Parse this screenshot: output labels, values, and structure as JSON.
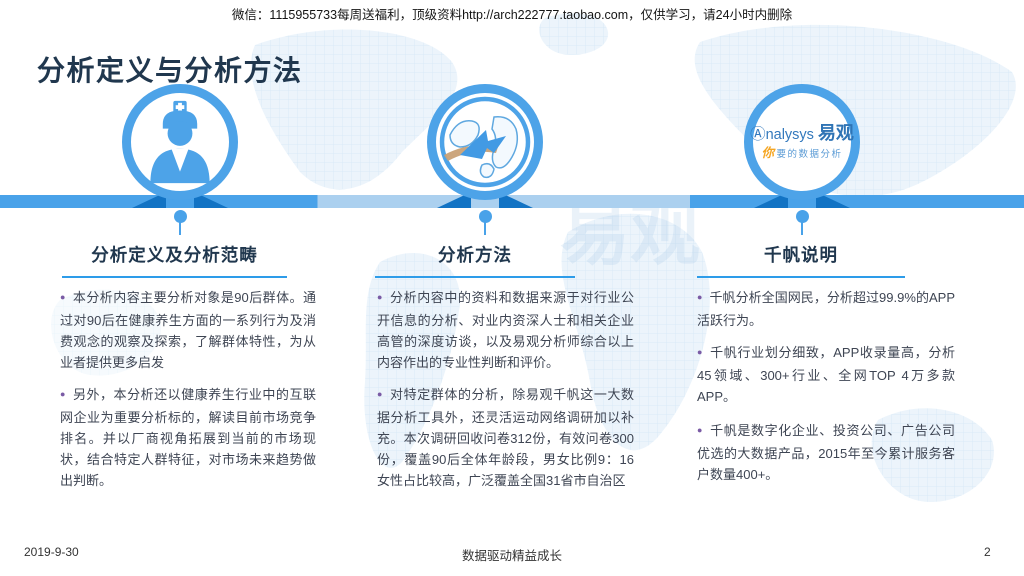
{
  "watermark_top": "微信：1115955733每周送福利，顶级资料http://arch222777.taobao.com，仅供学习，请24小时内删除",
  "page_title": "分析定义与分析方法",
  "glyphs": {
    "bullet": "●"
  },
  "columns": [
    {
      "heading": "分析定义及分析范畴",
      "icon": "nurse-icon",
      "bullets": [
        "本分析内容主要分析对象是90后群体。通过对90后在健康养生方面的一系列行为及消费观念的观察及探索，了解群体特性，为从业者提供更多启发",
        "另外，本分析还以健康养生行业中的互联网企业为重要分析标的，解读目前市场竞争排名。并以厂商视角拓展到当前的市场现状，结合特定人群特征，对市场未来趋势做出判断。"
      ]
    },
    {
      "heading": "分析方法",
      "icon": "globe-arrow-icon",
      "bullets": [
        "分析内容中的资料和数据来源于对行业公开信息的分析、对业内资深人士和相关企业高管的深度访谈，以及易观分析师综合以上内容作出的专业性判断和评价。",
        "对特定群体的分析，除易观千帆这一大数据分析工具外，还灵活运动网络调研加以补充。本次调研回收问卷312份，有效问卷300份，覆盖90后全体年龄段，男女比例9：16女性占比较高，广泛覆盖全国31省市自治区"
      ]
    },
    {
      "heading": "千帆说明",
      "icon": "analysys-logo",
      "bullets": [
        "千帆分析全国网民，分析超过99.9%的APP活跃行为。",
        "千帆行业划分细致，APP收录量高，分析45领域、300+行业、全网TOP 4万多款APP。",
        "千帆是数字化企业、投资公司、广告公司优选的大数据产品，2015年至今累计服务客户数量400+。"
      ]
    }
  ],
  "logo": {
    "brand_a": "Ⓐ",
    "brand_rest": "nalysys",
    "brand_cn": "易观",
    "tagline_head": "你",
    "tagline_rest": "要的数据分析"
  },
  "background_watermark": "易观",
  "footer": {
    "date": "2019-9-30",
    "motto": "数据驱动精益成长",
    "page_number": "2"
  },
  "colors": {
    "accent_blue": "#4DA3E8",
    "dark_ribbon_blue": "#1273C4",
    "band_light_blue": "#ABD0EF",
    "heading_navy": "#20374E",
    "underline_blue": "#2D9CE9",
    "bullet_purple": "#7A5BA5",
    "body_text": "#3E4553",
    "logo_blue": "#3379BD",
    "logo_orange": "#F5A623"
  }
}
